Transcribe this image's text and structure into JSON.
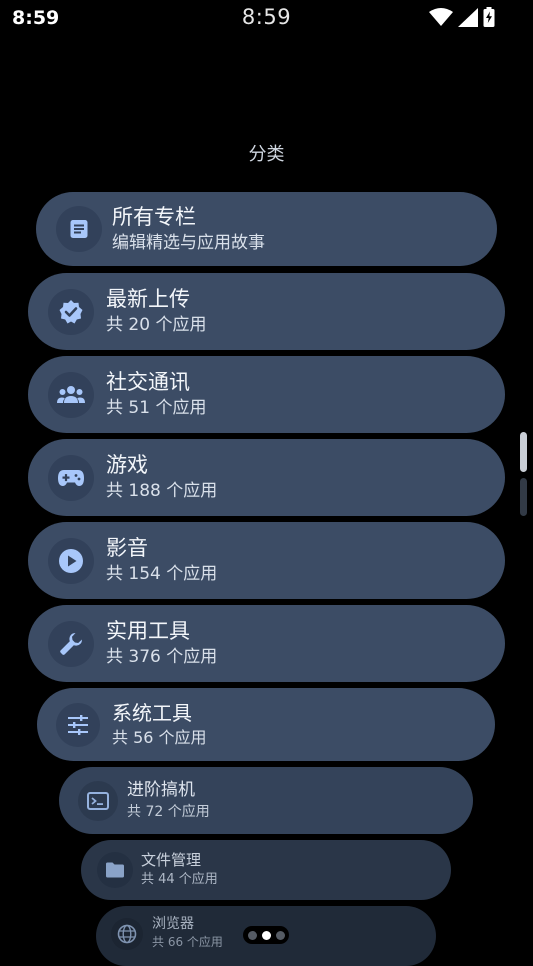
{
  "status_bar": {
    "time_left": "8:59",
    "time_center": "8:59",
    "icons": [
      "wifi-icon",
      "cellular-signal-icon",
      "battery-charging-icon"
    ]
  },
  "page_title": "分类",
  "categories": [
    {
      "title": "所有专栏",
      "subtitle": "编辑精选与应用故事",
      "icon": "article-icon"
    },
    {
      "title": "最新上传",
      "subtitle": "共 20 个应用",
      "icon": "verified-badge-icon"
    },
    {
      "title": "社交通讯",
      "subtitle": "共 51 个应用",
      "icon": "group-icon"
    },
    {
      "title": "游戏",
      "subtitle": "共 188 个应用",
      "icon": "gamepad-icon"
    },
    {
      "title": "影音",
      "subtitle": "共 154 个应用",
      "icon": "play-circle-icon"
    },
    {
      "title": "实用工具",
      "subtitle": "共 376 个应用",
      "icon": "wrench-icon"
    },
    {
      "title": "系统工具",
      "subtitle": "共 56 个应用",
      "icon": "tune-sliders-icon"
    },
    {
      "title": "进阶搞机",
      "subtitle": "共 72 个应用",
      "icon": "terminal-icon"
    },
    {
      "title": "文件管理",
      "subtitle": "共 44 个应用",
      "icon": "folder-icon"
    },
    {
      "title": "浏览器",
      "subtitle": "共 66 个应用",
      "icon": "globe-icon"
    }
  ],
  "colors": {
    "background": "#000000",
    "chip": "#3c4c65",
    "icon_circle": "#32415a",
    "icon_accent": "#a8c7fa"
  },
  "pagination": {
    "pages": 3,
    "active_index": 1
  }
}
